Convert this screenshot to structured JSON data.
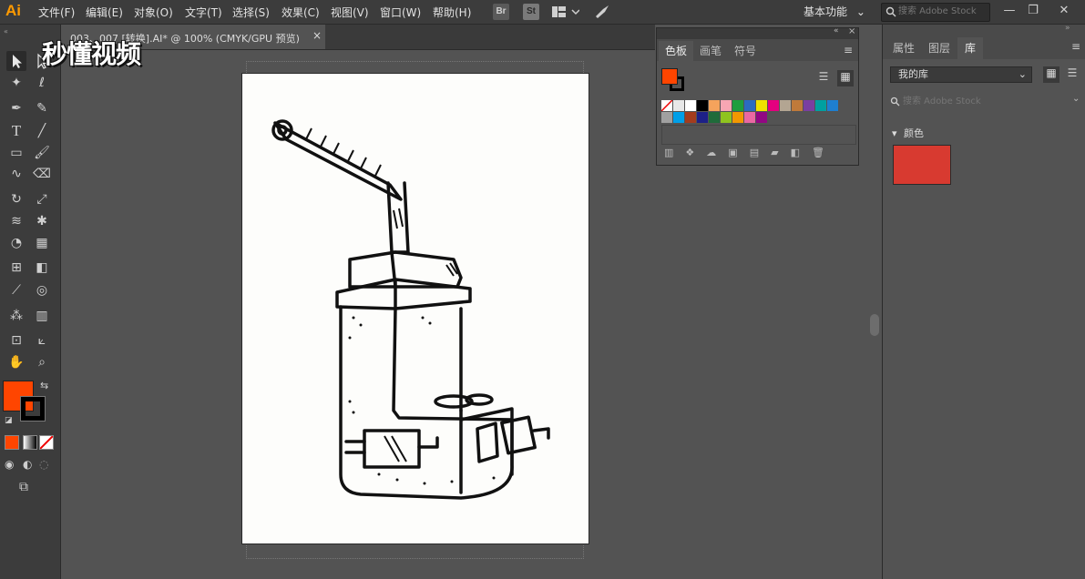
{
  "app": {
    "logo": "Ai"
  },
  "menu": [
    "文件(F)",
    "编辑(E)",
    "对象(O)",
    "文字(T)",
    "选择(S)",
    "效果(C)",
    "视图(V)",
    "窗口(W)",
    "帮助(H)"
  ],
  "app_icons": {
    "bridge": "Br",
    "stock": "St"
  },
  "workspace": {
    "label": "基本功能"
  },
  "search": {
    "placeholder": "搜索 Adobe Stock"
  },
  "window_controls": {
    "minimize": "—",
    "restore": "❐",
    "close": "✕"
  },
  "document_tab": {
    "label": "003、007 [转换].AI* @ 100% (CMYK/GPU 预览)",
    "close": "×"
  },
  "watermark": {
    "text": "秒懂视频"
  },
  "swatches_panel": {
    "tabs": [
      "色板",
      "画笔",
      "符号"
    ],
    "row1": [
      "none",
      "#e8e8e8",
      "#ffffff",
      "#000000",
      "#f5a35c",
      "#f7a6b3",
      "#1f9e3e",
      "#2b6bc1",
      "#f0e000",
      "#e4007f",
      "#b3a592",
      "#c07a3a",
      "#7a3fa0",
      "#00a0a0",
      "#1e7fd0"
    ],
    "row2": [
      "#a0a0a0",
      "#009fe8",
      "#a33c1e",
      "#1d2088",
      "#1f6b3a",
      "#8fc31f",
      "#f39800",
      "#ea68a2",
      "#920783"
    ]
  },
  "fill_color": "#ff4500",
  "right_dock": {
    "tabs": [
      "属性",
      "图层",
      "库"
    ],
    "library_name": "我的库",
    "search_placeholder": "搜索 Adobe Stock",
    "section_label": "颜色",
    "library_color": "#d83a30"
  },
  "artwork": {
    "icon": "tea-urn-illustration"
  }
}
